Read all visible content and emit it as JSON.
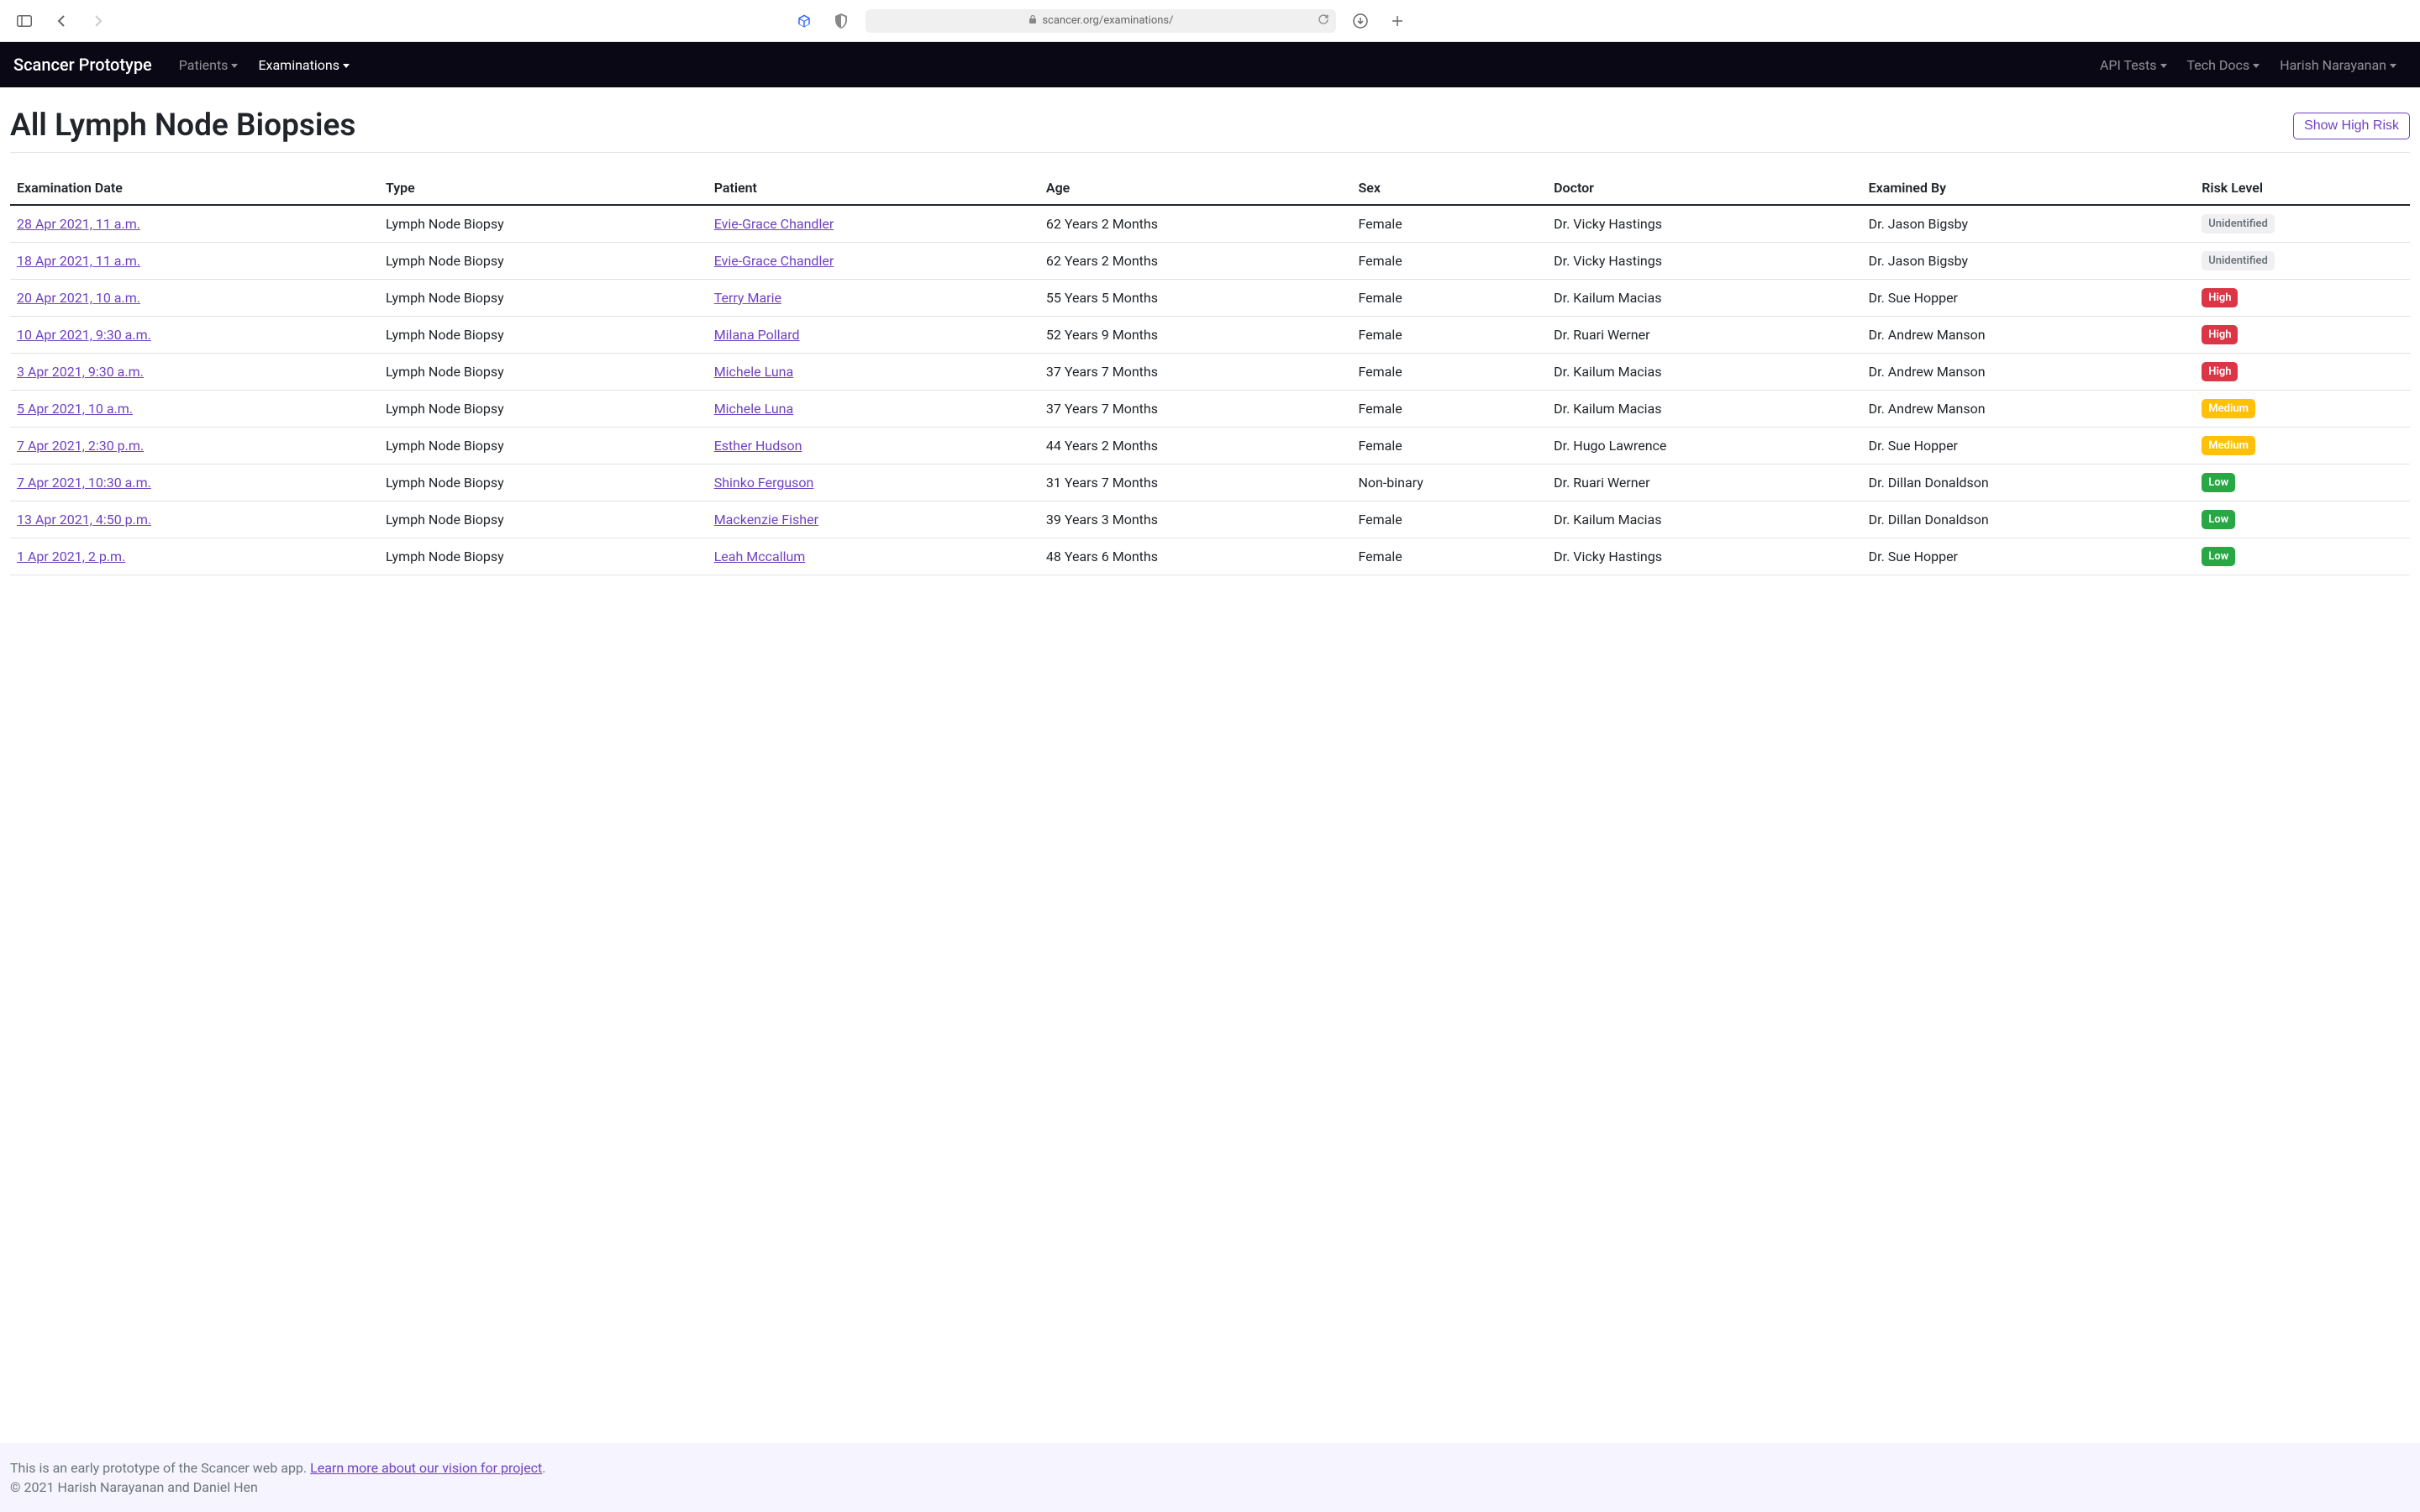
{
  "browser": {
    "url": "scancer.org/examinations/"
  },
  "navbar": {
    "brand": "Scancer Prototype",
    "links": {
      "patients": "Patients",
      "examinations": "Examinations",
      "api_tests": "API Tests",
      "tech_docs": "Tech Docs",
      "user": "Harish Narayanan"
    }
  },
  "page": {
    "title": "All Lymph Node Biopsies",
    "filter_button": "Show High Risk"
  },
  "table": {
    "headers": {
      "date": "Examination Date",
      "type": "Type",
      "patient": "Patient",
      "age": "Age",
      "sex": "Sex",
      "doctor": "Doctor",
      "examined_by": "Examined By",
      "risk": "Risk Level"
    },
    "rows": [
      {
        "date": "28 Apr 2021, 11 a.m.",
        "type": "Lymph Node Biopsy",
        "patient": "Evie-Grace Chandler",
        "age": "62 Years 2 Months",
        "sex": "Female",
        "doctor": "Dr. Vicky Hastings",
        "examined_by": "Dr. Jason Bigsby",
        "risk": "Unidentified",
        "risk_class": "unidentified"
      },
      {
        "date": "18 Apr 2021, 11 a.m.",
        "type": "Lymph Node Biopsy",
        "patient": "Evie-Grace Chandler",
        "age": "62 Years 2 Months",
        "sex": "Female",
        "doctor": "Dr. Vicky Hastings",
        "examined_by": "Dr. Jason Bigsby",
        "risk": "Unidentified",
        "risk_class": "unidentified"
      },
      {
        "date": "20 Apr 2021, 10 a.m.",
        "type": "Lymph Node Biopsy",
        "patient": "Terry Marie",
        "age": "55 Years 5 Months",
        "sex": "Female",
        "doctor": "Dr. Kailum Macias",
        "examined_by": "Dr. Sue Hopper",
        "risk": "High",
        "risk_class": "high"
      },
      {
        "date": "10 Apr 2021, 9:30 a.m.",
        "type": "Lymph Node Biopsy",
        "patient": "Milana Pollard",
        "age": "52 Years 9 Months",
        "sex": "Female",
        "doctor": "Dr. Ruari Werner",
        "examined_by": "Dr. Andrew Manson",
        "risk": "High",
        "risk_class": "high"
      },
      {
        "date": "3 Apr 2021, 9:30 a.m.",
        "type": "Lymph Node Biopsy",
        "patient": "Michele Luna",
        "age": "37 Years 7 Months",
        "sex": "Female",
        "doctor": "Dr. Kailum Macias",
        "examined_by": "Dr. Andrew Manson",
        "risk": "High",
        "risk_class": "high"
      },
      {
        "date": "5 Apr 2021, 10 a.m.",
        "type": "Lymph Node Biopsy",
        "patient": "Michele Luna",
        "age": "37 Years 7 Months",
        "sex": "Female",
        "doctor": "Dr. Kailum Macias",
        "examined_by": "Dr. Andrew Manson",
        "risk": "Medium",
        "risk_class": "medium"
      },
      {
        "date": "7 Apr 2021, 2:30 p.m.",
        "type": "Lymph Node Biopsy",
        "patient": "Esther Hudson",
        "age": "44 Years 2 Months",
        "sex": "Female",
        "doctor": "Dr. Hugo Lawrence",
        "examined_by": "Dr. Sue Hopper",
        "risk": "Medium",
        "risk_class": "medium"
      },
      {
        "date": "7 Apr 2021, 10:30 a.m.",
        "type": "Lymph Node Biopsy",
        "patient": "Shinko Ferguson",
        "age": "31 Years 7 Months",
        "sex": "Non-binary",
        "doctor": "Dr. Ruari Werner",
        "examined_by": "Dr. Dillan Donaldson",
        "risk": "Low",
        "risk_class": "low"
      },
      {
        "date": "13 Apr 2021, 4:50 p.m.",
        "type": "Lymph Node Biopsy",
        "patient": "Mackenzie Fisher",
        "age": "39 Years 3 Months",
        "sex": "Female",
        "doctor": "Dr. Kailum Macias",
        "examined_by": "Dr. Dillan Donaldson",
        "risk": "Low",
        "risk_class": "low"
      },
      {
        "date": "1 Apr 2021, 2 p.m.",
        "type": "Lymph Node Biopsy",
        "patient": "Leah Mccallum",
        "age": "48 Years 6 Months",
        "sex": "Female",
        "doctor": "Dr. Vicky Hastings",
        "examined_by": "Dr. Sue Hopper",
        "risk": "Low",
        "risk_class": "low"
      }
    ]
  },
  "footer": {
    "text_prefix": "This is an early prototype of the Scancer web app. ",
    "link_text": "Learn more about our vision for project",
    "text_suffix": ".",
    "copyright": "© 2021 Harish Narayanan and Daniel Hen"
  }
}
